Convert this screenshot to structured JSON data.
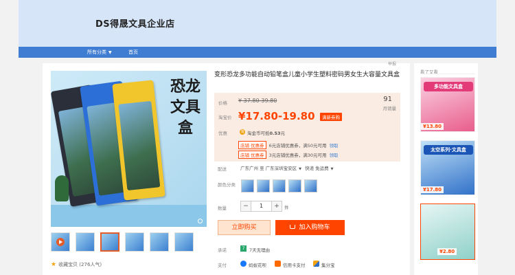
{
  "shop": {
    "name": "DS得晟文具企业店"
  },
  "nav": {
    "all_categories": "所有分类",
    "home": "首页"
  },
  "top_link": "举报",
  "product": {
    "title": "变形恐龙多功能自动铅笔盒儿童小学生塑料密码男女生大容量文具盒",
    "image_text": "恐龙文具盒",
    "price_label": "价格",
    "old_price": "¥ 37.80-39.80",
    "sale_price_label": "淘宝价",
    "sale_price": "¥17.80-19.80",
    "promo_badge": "满新券购",
    "monthly_sales": "91",
    "monthly_sales_label": "月销量",
    "benefit_label": "优惠",
    "coin_text_prefix": "淘金币可抵",
    "coin_amount": "0.53",
    "coin_unit": "元",
    "coupons": [
      {
        "tag": "店铺 优惠券",
        "text": "6元店铺优惠券，满50元可用",
        "action": "领取"
      },
      {
        "tag": "店铺 优惠券",
        "text": "3元店铺优惠券，满30元可用",
        "action": "领取"
      }
    ],
    "shipping_label": "配送",
    "shipping_from": "广东广州 至",
    "shipping_to": "广东深圳宝安区",
    "shipping_fee": "快递 免运费",
    "color_label": "颜色分类",
    "quantity_label": "数量",
    "quantity": "1",
    "quantity_unit": "件",
    "buy_now": "立即购买",
    "add_to_cart": "加入购物车",
    "promise_label": "承诺",
    "promise_icon": "7",
    "promise_text": "7天无理由",
    "payment_label": "支付",
    "payments": [
      "蚂蚁花呗",
      "信用卡支付",
      "集分宝"
    ],
    "favorites": "收藏宝贝 (276人气)"
  },
  "sidebar": {
    "title": "看了又看",
    "items": [
      {
        "banner": "多功能文具盒",
        "price": "¥13.80",
        "color": "#e85a8a"
      },
      {
        "banner": "太空系列·文具盒",
        "price": "¥17.80",
        "color": "#2e6fc8"
      },
      {
        "banner": "",
        "price": "¥2.80",
        "color": "#8fd0c9"
      }
    ]
  },
  "colors": {
    "accent": "#ff4400",
    "nav": "#3f7dd2",
    "header": "#d6e6f8"
  }
}
